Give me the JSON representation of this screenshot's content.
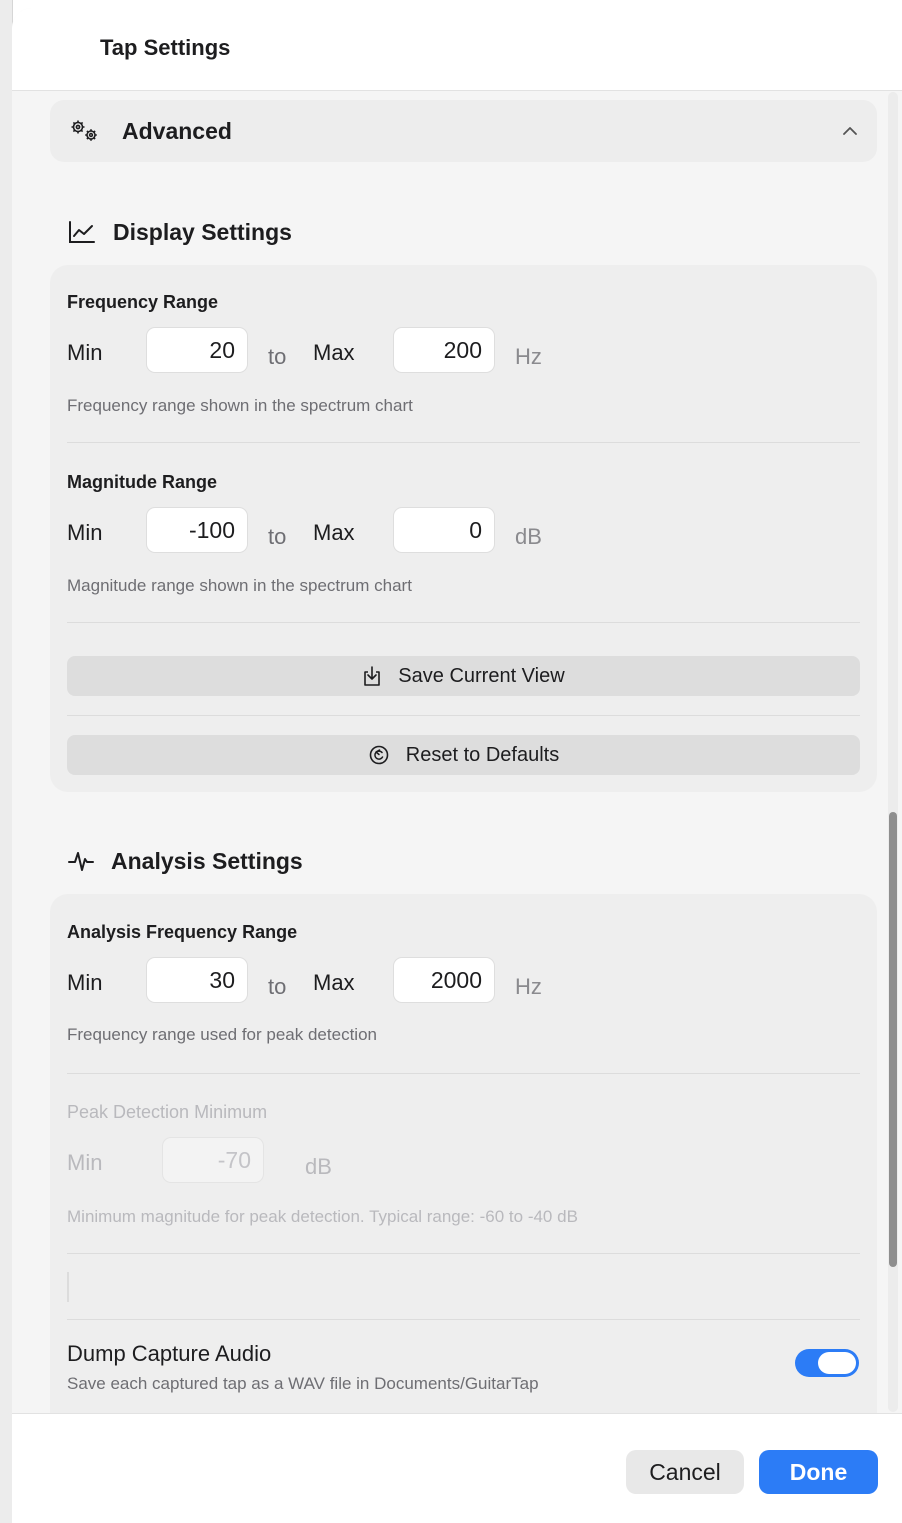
{
  "window": {
    "title": "Tap Settings"
  },
  "advanced": {
    "label": "Advanced",
    "icon": "gears-icon",
    "expand_icon": "chevron-up-icon"
  },
  "display_settings": {
    "title": "Display Settings",
    "icon": "chart-line-icon",
    "frequency_range": {
      "label": "Frequency Range",
      "min_label": "Min",
      "min_value": "20",
      "to_label": "to",
      "max_label": "Max",
      "max_value": "200",
      "unit": "Hz",
      "hint": "Frequency range shown in the spectrum chart"
    },
    "magnitude_range": {
      "label": "Magnitude Range",
      "min_label": "Min",
      "min_value": "-100",
      "to_label": "to",
      "max_label": "Max",
      "max_value": "0",
      "unit": "dB",
      "hint": "Magnitude range shown in the spectrum chart"
    },
    "save_view_label": "Save Current View",
    "reset_defaults_label": "Reset to Defaults"
  },
  "analysis_settings": {
    "title": "Analysis Settings",
    "icon": "waveform-icon",
    "analysis_frequency_range": {
      "label": "Analysis Frequency Range",
      "min_label": "Min",
      "min_value": "30",
      "to_label": "to",
      "max_label": "Max",
      "max_value": "2000",
      "unit": "Hz",
      "hint": "Frequency range used for peak detection"
    },
    "peak_detection": {
      "label": "Peak Detection Minimum",
      "min_label": "Min",
      "min_value": "-70",
      "unit": "dB",
      "hint": "Minimum magnitude for peak detection. Typical range: -60 to -40 dB"
    },
    "dump_capture": {
      "label": "Dump Capture Audio",
      "description": "Save each captured tap as a WAV file in Documents/GuitarTap",
      "enabled": true
    }
  },
  "footer": {
    "cancel_label": "Cancel",
    "done_label": "Done"
  },
  "colors": {
    "accent": "#2c7cf6",
    "card": "#eeeeee",
    "background": "#f5f5f5"
  }
}
